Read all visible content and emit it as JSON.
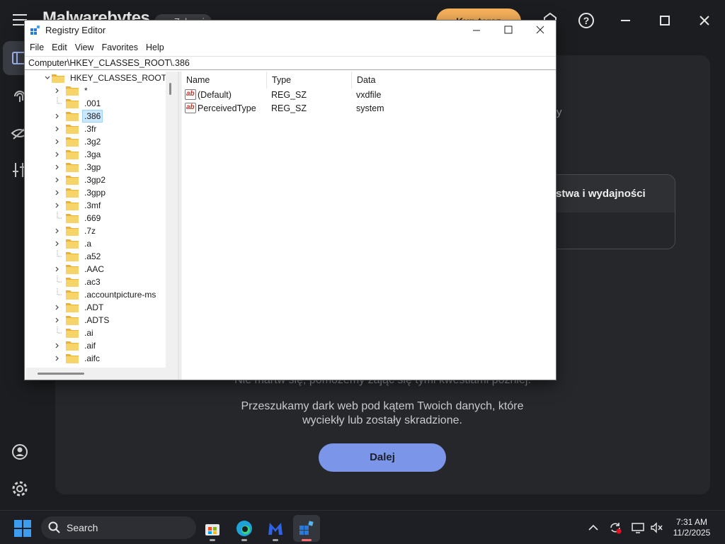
{
  "background_app": {
    "logo": "Malwarebytes",
    "chip_label": "Zaloguj",
    "upgrade_label": "Kup teraz",
    "faint_text_right": "y",
    "card_title": "stwa i wydajności",
    "notice": "Nie martw się, pomożemy zająć się tymi kwestiami później.",
    "description": "Przeszukamy dark web pod kątem Twoich danych, które wyciekły lub zostały skradzione.",
    "next_button": "Dalej"
  },
  "registry_editor": {
    "title": "Registry Editor",
    "menu": [
      "File",
      "Edit",
      "View",
      "Favorites",
      "Help"
    ],
    "address": "Computer\\HKEY_CLASSES_ROOT\\.386",
    "tree": {
      "root": "HKEY_CLASSES_ROOT",
      "items": [
        {
          "label": "*",
          "expandable": true
        },
        {
          "label": ".001",
          "expandable": false
        },
        {
          "label": ".386",
          "expandable": true,
          "selected": true
        },
        {
          "label": ".3fr",
          "expandable": true
        },
        {
          "label": ".3g2",
          "expandable": true
        },
        {
          "label": ".3ga",
          "expandable": true
        },
        {
          "label": ".3gp",
          "expandable": true
        },
        {
          "label": ".3gp2",
          "expandable": true
        },
        {
          "label": ".3gpp",
          "expandable": true
        },
        {
          "label": ".3mf",
          "expandable": true
        },
        {
          "label": ".669",
          "expandable": false
        },
        {
          "label": ".7z",
          "expandable": true
        },
        {
          "label": ".a",
          "expandable": true
        },
        {
          "label": ".a52",
          "expandable": false
        },
        {
          "label": ".AAC",
          "expandable": true
        },
        {
          "label": ".ac3",
          "expandable": false
        },
        {
          "label": ".accountpicture-ms",
          "expandable": false
        },
        {
          "label": ".ADT",
          "expandable": true
        },
        {
          "label": ".ADTS",
          "expandable": true
        },
        {
          "label": ".ai",
          "expandable": false
        },
        {
          "label": ".aif",
          "expandable": true
        },
        {
          "label": ".aifc",
          "expandable": true
        }
      ]
    },
    "columns": [
      "Name",
      "Type",
      "Data"
    ],
    "values": [
      {
        "name": "(Default)",
        "type": "REG_SZ",
        "data": "vxdfile"
      },
      {
        "name": "PerceivedType",
        "type": "REG_SZ",
        "data": "system"
      }
    ]
  },
  "taskbar": {
    "search_label": "Search",
    "time": "7:31 AM",
    "date": "11/2/2025"
  },
  "colors": {
    "accent_button": "#7b95e8",
    "upgrade": "#f6b15c",
    "selection": "#cce8ff",
    "folder": "#f3c84a"
  }
}
